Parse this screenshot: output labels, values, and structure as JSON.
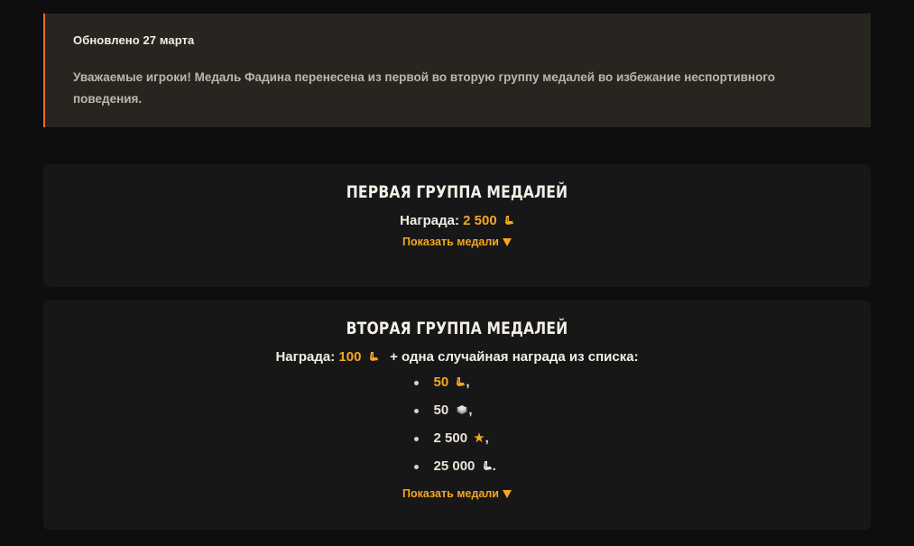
{
  "notice": {
    "date": "Обновлено 27 марта",
    "text": "Уважаемые игроки! Медаль Фадина перенесена из первой во вторую группу медалей во избежание неспортивного поведения."
  },
  "group1": {
    "title": "ПЕРВАЯ ГРУППА МЕДАЛЕЙ",
    "reward_label": "Награда:",
    "reward_value": "2 500",
    "show_label": "Показать медали"
  },
  "group2": {
    "title": "ВТОРАЯ ГРУППА МЕДАЛЕЙ",
    "reward_label": "Награда:",
    "reward_value": "100",
    "reward_suffix": "+ одна случайная награда из списка:",
    "items": [
      {
        "value": "50",
        "icon": "bond-icon",
        "punct": ","
      },
      {
        "value": "50",
        "icon": "credits-icon",
        "punct": ","
      },
      {
        "value": "2 500",
        "icon": "free-xp-star-icon",
        "punct": ","
      },
      {
        "value": "25 000",
        "icon": "bond-white-icon",
        "punct": "."
      }
    ],
    "show_label": "Показать медали"
  },
  "colors": {
    "accent": "#f6a623",
    "notice_border": "#e36d2b",
    "notice_bg": "#282521",
    "card_bg": "#171717",
    "page_bg": "#0e0e0e"
  }
}
